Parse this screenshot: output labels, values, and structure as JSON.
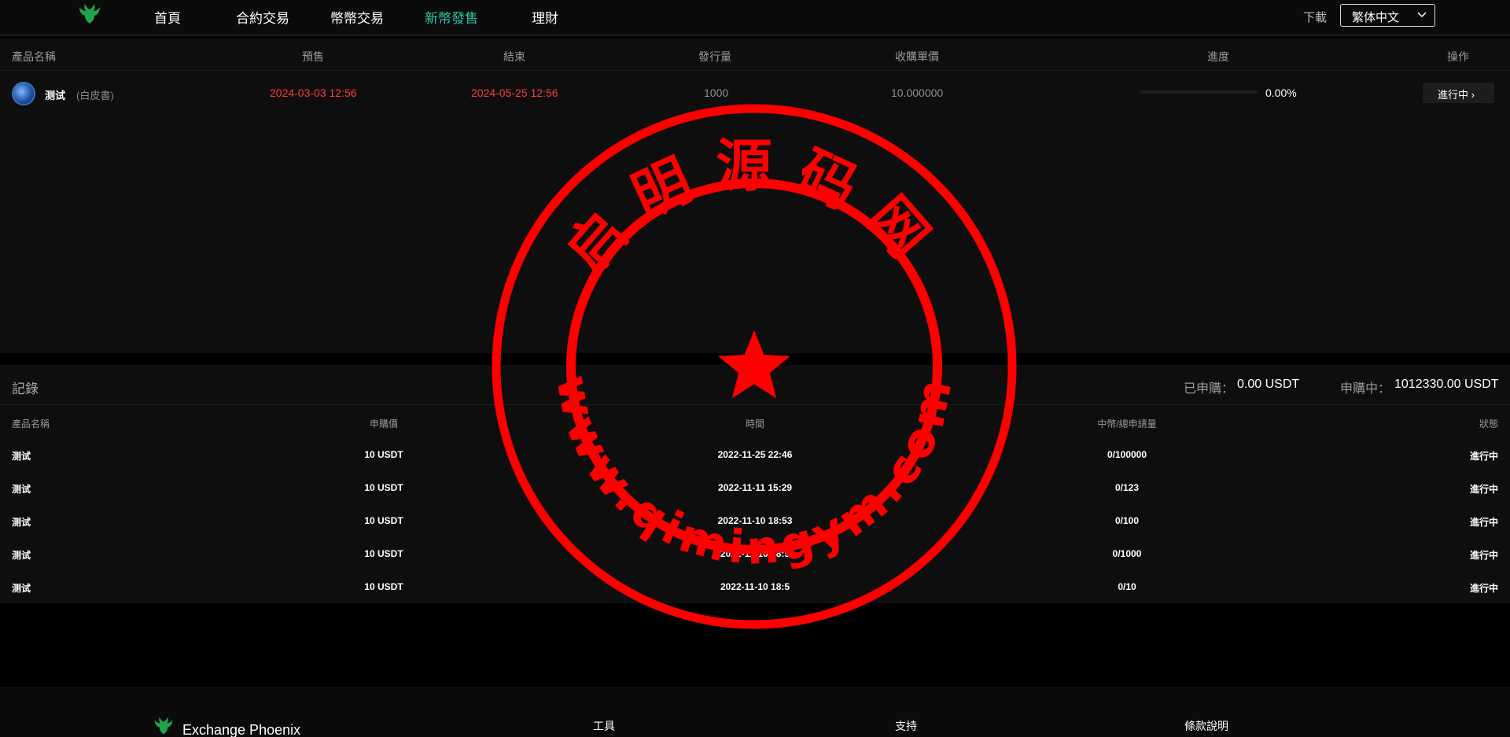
{
  "nav": {
    "items": [
      "首頁",
      "合約交易",
      "幣幣交易",
      "新幣發售",
      "理財"
    ],
    "active": "新幣發售",
    "download": "下載",
    "language": "繁体中文"
  },
  "products": {
    "columns": {
      "name": "產品名稱",
      "presale": "預售",
      "end": "結束",
      "issued": "發行量",
      "price": "收購單價",
      "progress": "進度",
      "action": "操作"
    },
    "row": {
      "name": "测试",
      "whitepaper": "(白皮書)",
      "presale": "2024-03-03 12:56",
      "end": "2024-05-25 12:56",
      "issued": "1000",
      "price": "10.000000",
      "progress_value": 0.0,
      "progress_text": "0.00%",
      "status": "進行中",
      "status_arrow": "›"
    }
  },
  "records": {
    "title": "記錄",
    "subscribed_label": "已申購：",
    "subscribed_value": "0.00 USDT",
    "subscribing_label": "申購中：",
    "subscribing_value": "1012330.00 USDT",
    "columns": {
      "name": "產品名稱",
      "price": "申購價",
      "time": "時間",
      "quantity": "中幣/總申請量",
      "status": "狀態"
    },
    "rows": [
      {
        "name": "测试",
        "price": "10 USDT",
        "time": "2022-11-25 22:46",
        "quantity": "0/100000",
        "status": "進行中"
      },
      {
        "name": "测试",
        "price": "10 USDT",
        "time": "2022-11-11 15:29",
        "quantity": "0/123",
        "status": "進行中"
      },
      {
        "name": "测试",
        "price": "10 USDT",
        "time": "2022-11-10 18:53",
        "quantity": "0/100",
        "status": "進行中"
      },
      {
        "name": "测试",
        "price": "10 USDT",
        "time": "2022-11-10 18:5",
        "quantity": "0/1000",
        "status": "進行中"
      },
      {
        "name": "测试",
        "price": "10 USDT",
        "time": "2022-11-10 18:5",
        "quantity": "0/10",
        "status": "進行中"
      }
    ]
  },
  "footer": {
    "brand": "Exchange Phoenix",
    "columns": [
      "工具",
      "支持",
      "條款說明"
    ]
  },
  "watermark": {
    "top_text": "启明源码网",
    "bottom_text": "www.qimingym.com",
    "color": "#ff0000"
  },
  "colors": {
    "accent": "#2fc7a3",
    "date_red": "#ff3b3b",
    "logo_green": "#1fa34a"
  }
}
